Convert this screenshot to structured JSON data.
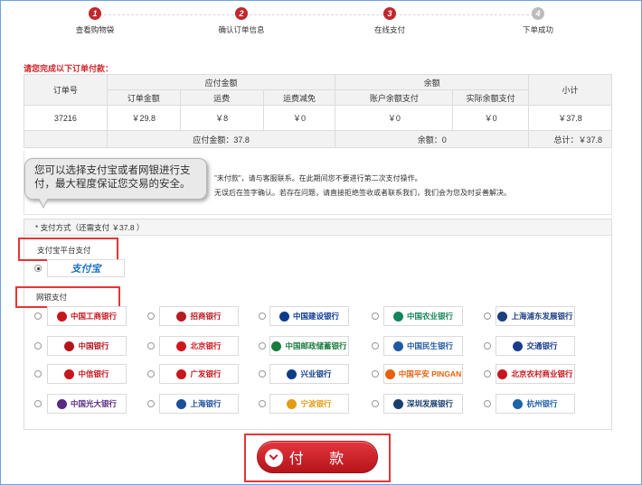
{
  "steps": [
    {
      "num": "1",
      "label": "查看购物袋",
      "active": true
    },
    {
      "num": "2",
      "label": "确认订单信息",
      "active": true
    },
    {
      "num": "3",
      "label": "在线支付",
      "active": true
    },
    {
      "num": "4",
      "label": "下单成功",
      "active": false
    }
  ],
  "notice": "请您完成以下订单付款：",
  "table": {
    "order_no_header": "订单号",
    "payable_header": "应付金额",
    "balance_header": "余额",
    "subtotal_header": "小计",
    "sub_headers": [
      "订单金额",
      "运费",
      "运费减免",
      "账户余额支付",
      "实际余额支付"
    ],
    "row": {
      "order_no": "37216",
      "amount": "￥29.8",
      "shipping": "￥8",
      "shipping_discount": "￥0",
      "account_balance": "￥0",
      "actual_balance": "￥0",
      "subtotal": "￥37.8"
    },
    "totals": {
      "payable": "应付金额：37.8",
      "balance": "余额：0",
      "total": "总计：￥37.8"
    }
  },
  "instructions": {
    "line1": "\"未付款\"，请与客服联系。在此期间您不要进行第二次支付操作。",
    "line2": "无误后在签字确认。若存在问题，请直接拒绝签收或者联系我们，我们会为您及时妥善解决。"
  },
  "tooltip": "您可以选择支付宝或者网银进行支付，最大程度保证您交易的安全。",
  "payment": {
    "header": "* 支付方式（还需支付 ￥37.8 ）",
    "alipay_label": "支付宝平台支付",
    "alipay_logo": "支付宝",
    "bank_label": "网银支付",
    "banks": [
      {
        "name": "中国工商银行",
        "color": "#c8161d",
        "icon": "icbc-logo-icon"
      },
      {
        "name": "招商银行",
        "color": "#b71c22",
        "icon": "cmb-logo-icon"
      },
      {
        "name": "中国建设银行",
        "color": "#0b3a8f",
        "icon": "ccb-logo-icon"
      },
      {
        "name": "中国农业银行",
        "color": "#14845b",
        "icon": "abc-logo-icon"
      },
      {
        "name": "上海浦东发展银行",
        "color": "#1c3e7e",
        "icon": "spdb-logo-icon"
      },
      {
        "name": "中国银行",
        "color": "#b3151b",
        "icon": "boc-logo-icon"
      },
      {
        "name": "北京银行",
        "color": "#d0161d",
        "icon": "bob-logo-icon"
      },
      {
        "name": "中国邮政储蓄银行",
        "color": "#1b7b3d",
        "icon": "psbc-logo-icon"
      },
      {
        "name": "中国民生银行",
        "color": "#1f5aa0",
        "icon": "cmbc-logo-icon"
      },
      {
        "name": "交通银行",
        "color": "#1a3c8c",
        "icon": "bocom-logo-icon"
      },
      {
        "name": "中信银行",
        "color": "#c8161d",
        "icon": "citic-logo-icon"
      },
      {
        "name": "广发银行",
        "color": "#c8161d",
        "icon": "cgb-logo-icon"
      },
      {
        "name": "兴业银行",
        "color": "#0f3c86",
        "icon": "cib-logo-icon"
      },
      {
        "name": "中国平安 PINGAN",
        "color": "#e8600c",
        "icon": "pingan-logo-icon"
      },
      {
        "name": "北京农村商业银行",
        "color": "#c8161d",
        "icon": "bjrcb-logo-icon"
      },
      {
        "name": "中国光大银行",
        "color": "#5a2a82",
        "icon": "ceb-logo-icon"
      },
      {
        "name": "上海银行",
        "color": "#1d4f9a",
        "icon": "bosh-logo-icon"
      },
      {
        "name": "宁波银行",
        "color": "#e39b16",
        "icon": "nbcb-logo-icon"
      },
      {
        "name": "深圳发展银行",
        "color": "#17406f",
        "icon": "sdb-logo-icon"
      },
      {
        "name": "杭州银行",
        "color": "#1f63a8",
        "icon": "hzb-logo-icon"
      }
    ]
  },
  "pay_button": "付 款"
}
